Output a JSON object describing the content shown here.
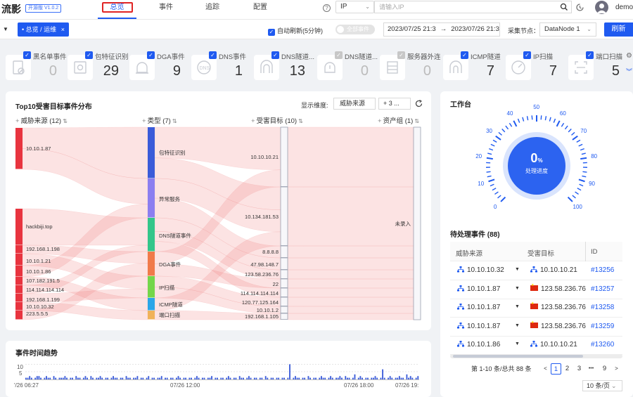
{
  "app": {
    "logo": "流影",
    "version": "开源版 V1.0.2"
  },
  "nav": {
    "items": [
      "总览",
      "事件",
      "追踪",
      "配置"
    ],
    "active": "总览"
  },
  "search": {
    "type": "IP",
    "placeholder": "请输入IP"
  },
  "user": {
    "name": "demo"
  },
  "filterbar": {
    "chip": "总览 / 运维",
    "chip_close": "×",
    "auto_refresh": "自动刷新(5分钟)",
    "all_events_toggle": "全部事件",
    "date_from": "2023/07/25 21:3",
    "date_to": "2023/07/26 21:3",
    "node_label": "采集节点：",
    "node_value": "DataNode 1",
    "refresh": "刷新"
  },
  "stats": [
    {
      "label": "黑名单事件",
      "value": "0",
      "checked": true,
      "icon": "blacklist-icon"
    },
    {
      "label": "包特征识别",
      "value": "29",
      "checked": true,
      "icon": "packet-feature-icon"
    },
    {
      "label": "DGA事件",
      "value": "9",
      "checked": true,
      "icon": "dga-alarm-icon"
    },
    {
      "label": "DNS事件",
      "value": "1",
      "checked": true,
      "icon": "dns-icon"
    },
    {
      "label": "DNS隧道...",
      "value": "13",
      "checked": true,
      "icon": "dns-tunnel-icon"
    },
    {
      "label": "DNS隧道...",
      "value": "0",
      "checked": false,
      "icon": "dns-tunnel-alarm-icon"
    },
    {
      "label": "服务器外连",
      "value": "0",
      "checked": false,
      "icon": "server-outbound-icon"
    },
    {
      "label": "ICMP隧道",
      "value": "7",
      "checked": true,
      "icon": "icmp-tunnel-icon"
    },
    {
      "label": "IP扫描",
      "value": "7",
      "checked": true,
      "icon": "ip-scan-icon"
    },
    {
      "label": "端口扫描",
      "value": "5",
      "checked": true,
      "icon": "port-scan-icon"
    }
  ],
  "sankey": {
    "title": "Top10受害目标事件分布",
    "dim_label": "显示维度:",
    "dim_value": "威胁来源",
    "dim_more": "+ 3 ...",
    "columns": [
      "威胁来源 (12)",
      "类型 (7)",
      "受害目标 (10)",
      "资产组 (1)"
    ],
    "sources": [
      "10.10.1.87",
      "hackbiji.top",
      "192.168.1.198",
      "10.10.1.21",
      "10.10.1.86",
      "107.182.191.5",
      "114.114.114.114",
      "192.168.1.199",
      "10.10.10.32",
      "223.5.5.5"
    ],
    "types": [
      "包特征识别",
      "异常服务",
      "DNS隧道事件",
      "DGA事件",
      "IP扫描",
      "ICMP隧道",
      "端口扫描"
    ],
    "targets": [
      "10.10.10.21",
      "10.134.181.53",
      "8.8.8.8",
      "47.98.148.7",
      "123.58.236.76",
      "22",
      "114.114.114.114",
      "120.77.125.164",
      "10.10.1.2",
      "192.168.1.105"
    ],
    "groups": [
      "未录入"
    ],
    "type_colors": [
      "#3a5bd9",
      "#8b7ef0",
      "#32c68a",
      "#f07a4a",
      "#74d64a",
      "#2aa6e8",
      "#f0b25a"
    ]
  },
  "trend": {
    "title": "事件时间趋势",
    "y_ticks": [
      "10",
      "5"
    ],
    "x_ticks": [
      "'/26 06:27",
      "07/26 12:00",
      "07/26 18:00",
      "07/26 19:"
    ],
    "bars": [
      1,
      1,
      2,
      1,
      0,
      1,
      2,
      2,
      1,
      0,
      1,
      2,
      1,
      1,
      0,
      2,
      1,
      0,
      1,
      1,
      1,
      2,
      1,
      0,
      1,
      1,
      0,
      2,
      1,
      1,
      0,
      1,
      2,
      1,
      0,
      2,
      1,
      0,
      1,
      1,
      2,
      1,
      0,
      1,
      1,
      0,
      1,
      2,
      1,
      1,
      0,
      1,
      1,
      0,
      2,
      1,
      1,
      0,
      1,
      1,
      2,
      0,
      1,
      1,
      0,
      1,
      2,
      0,
      1,
      1,
      0,
      1,
      1,
      2,
      0,
      1,
      1,
      0,
      1,
      1,
      0,
      1,
      2,
      1,
      0,
      1,
      1,
      0,
      1,
      1,
      0,
      1,
      2,
      1,
      0,
      1,
      1,
      0,
      1,
      1,
      2,
      0,
      1,
      1,
      0,
      1,
      1,
      0,
      1,
      2,
      1,
      0,
      1,
      1,
      0,
      2,
      1,
      1,
      0,
      1,
      2,
      1,
      0,
      1,
      1,
      0,
      1,
      1,
      0,
      2,
      1,
      0,
      1,
      1,
      0,
      1,
      1,
      0,
      1,
      1,
      0,
      1,
      9,
      0,
      1,
      2,
      1,
      1,
      0,
      1,
      1,
      0,
      2,
      1,
      0,
      1,
      1,
      0,
      1,
      2,
      1,
      1,
      0,
      1,
      2,
      1,
      0,
      1,
      1,
      2,
      1,
      0,
      2,
      1,
      1,
      0,
      1,
      3,
      0,
      1,
      2,
      1,
      0,
      1,
      1,
      0,
      1,
      1,
      2,
      1,
      0,
      1,
      6,
      1,
      0,
      1,
      2,
      1,
      0,
      1,
      1,
      2,
      1,
      1,
      0,
      3,
      1,
      2,
      1,
      0,
      1,
      2
    ]
  },
  "workbench": {
    "title": "工作台",
    "gauge_value": "0",
    "gauge_unit": "%",
    "gauge_caption": "处理进度",
    "gauge_ticks": [
      "0",
      "10",
      "20",
      "30",
      "40",
      "50",
      "60",
      "70",
      "80",
      "90",
      "100"
    ],
    "pending_title": "待处理事件 (88)",
    "headers": [
      "威胁来源",
      "受害目标",
      "ID"
    ],
    "rows": [
      {
        "src": "10.10.10.32",
        "dst": "10.10.10.21",
        "dst_flag": false,
        "id": "#13256"
      },
      {
        "src": "10.10.1.87",
        "dst": "123.58.236.76",
        "dst_flag": true,
        "id": "#13257"
      },
      {
        "src": "10.10.1.87",
        "dst": "123.58.236.76",
        "dst_flag": true,
        "id": "#13258"
      },
      {
        "src": "10.10.1.87",
        "dst": "123.58.236.76",
        "dst_flag": true,
        "id": "#13259"
      },
      {
        "src": "10.10.1.86",
        "dst": "10.10.10.21",
        "dst_flag": false,
        "id": "#13260"
      }
    ],
    "pager": {
      "summary": "第 1-10 条/总共 88 条",
      "pages": [
        "1",
        "2",
        "3",
        "•••",
        "9"
      ],
      "active": "1",
      "page_size": "10 条/页"
    }
  }
}
